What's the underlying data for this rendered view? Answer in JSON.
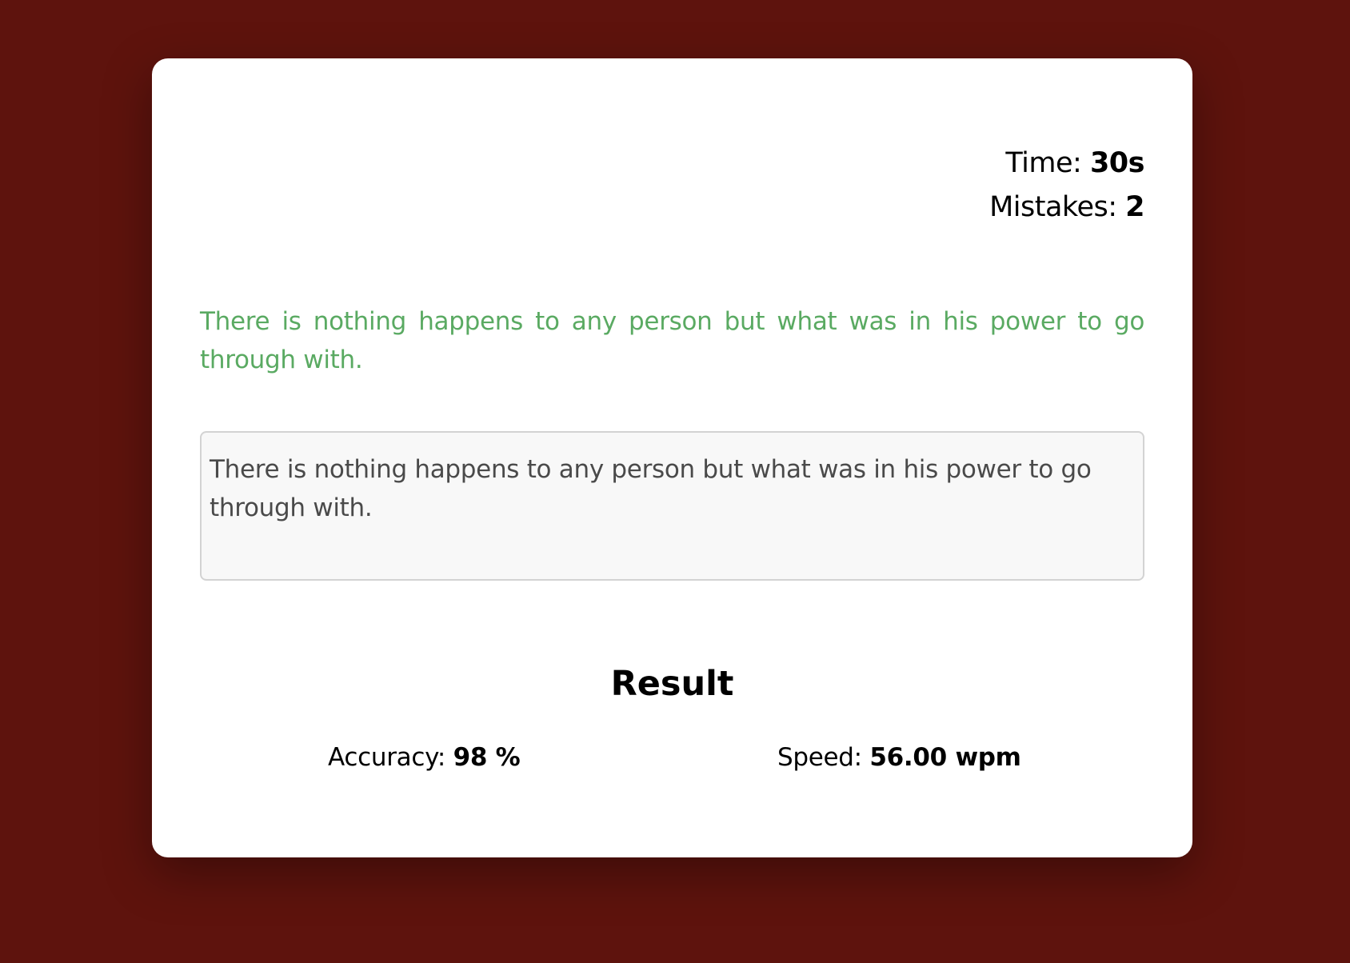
{
  "colors": {
    "background": "#5e130d",
    "card": "#ffffff",
    "quote_text": "#5aaa62",
    "input_bg": "#f8f8f8"
  },
  "stats": {
    "time_label": "Time: ",
    "time_value": "30s",
    "mistakes_label": "Mistakes: ",
    "mistakes_value": "2"
  },
  "quote": {
    "text": "There is nothing happens to any person but what was in his power to go through with."
  },
  "typing_input": {
    "value": "There is nothing happens to any person but what was in his power to go through with."
  },
  "result": {
    "title": "Result",
    "accuracy_label": "Accuracy: ",
    "accuracy_value": "98 %",
    "speed_label": "Speed: ",
    "speed_value": "56.00 wpm"
  }
}
